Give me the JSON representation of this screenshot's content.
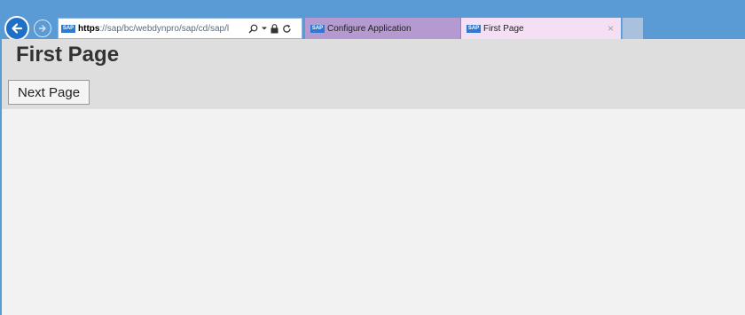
{
  "browser": {
    "address_bar": {
      "url_protocol": "https",
      "url_rest": "://sap/bc/webdynpro/sap/cd/sap/l",
      "site_icon": "sap-logo"
    },
    "icons": {
      "back": "back-arrow-icon",
      "forward": "forward-arrow-icon",
      "search": "search-icon",
      "lock": "lock-icon",
      "refresh": "refresh-icon"
    },
    "tabs": [
      {
        "label": "Configure Application",
        "active": false
      },
      {
        "label": "First Page",
        "active": true,
        "close": "×"
      }
    ]
  },
  "page": {
    "title": "First Page",
    "next_button_label": "Next Page"
  },
  "colors": {
    "chrome": "#5b9bd5",
    "header_bg": "#dedede",
    "content_bg": "#f2f2f2",
    "tab_inactive": "#b59ad2",
    "tab_active": "#f5dff5"
  }
}
